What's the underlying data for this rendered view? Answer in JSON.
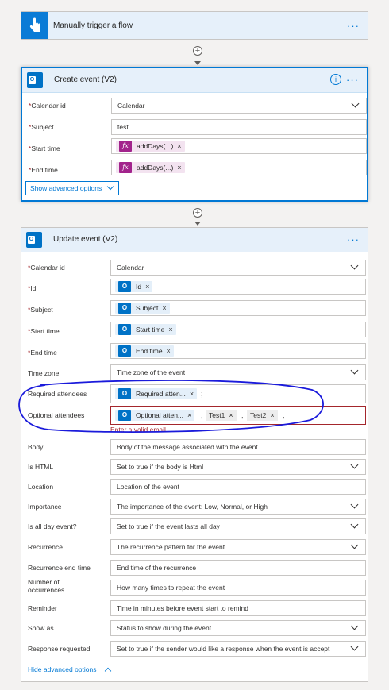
{
  "trigger": {
    "title": "Manually trigger a flow",
    "menu": "···"
  },
  "create": {
    "title": "Create event (V2)",
    "menu": "···",
    "info": "i",
    "rows": [
      {
        "label": "Calendar id",
        "required": "*",
        "value": "Calendar"
      },
      {
        "label": "Subject",
        "required": "*",
        "value": "test"
      },
      {
        "label": "Start time",
        "required": "*",
        "token": "addDays(...)",
        "fx": "fx"
      },
      {
        "label": "End time",
        "required": "*",
        "token": "addDays(...)",
        "fx": "fx"
      }
    ],
    "advanced": "Show advanced options"
  },
  "update": {
    "title": "Update event (V2)",
    "menu": "···",
    "calendar": {
      "label": "Calendar id",
      "value": "Calendar"
    },
    "id": {
      "label": "Id",
      "token": "Id"
    },
    "subject": {
      "label": "Subject",
      "token": "Subject"
    },
    "start": {
      "label": "Start time",
      "token": "Start time"
    },
    "end": {
      "label": "End time",
      "token": "End time"
    },
    "timezone": {
      "label": "Time zone",
      "placeholder": "Time zone of the event"
    },
    "required_att": {
      "label": "Required attendees",
      "token": "Required atten..."
    },
    "optional_att": {
      "label": "Optional attendees",
      "token": "Optional atten...",
      "extra": [
        "Test1",
        "Test2"
      ]
    },
    "error": "Enter a valid email",
    "fields": [
      {
        "label": "Body",
        "placeholder": "Body of the message associated with the event",
        "dropdown": false
      },
      {
        "label": "Is HTML",
        "placeholder": "Set to true if the body is Html",
        "dropdown": true
      },
      {
        "label": "Location",
        "placeholder": "Location of the event",
        "dropdown": false
      },
      {
        "label": "Importance",
        "placeholder": "The importance of the event: Low, Normal, or High",
        "dropdown": true
      },
      {
        "label": "Is all day event?",
        "placeholder": "Set to true if the event lasts all day",
        "dropdown": true
      },
      {
        "label": "Recurrence",
        "placeholder": "The recurrence pattern for the event",
        "dropdown": true
      },
      {
        "label": "Recurrence end time",
        "placeholder": "End time of the recurrence",
        "dropdown": false
      },
      {
        "label": "Number of occurrences",
        "placeholder": "How many times to repeat the event",
        "dropdown": false
      },
      {
        "label": "Reminder",
        "placeholder": "Time in minutes before event start to remind",
        "dropdown": false
      },
      {
        "label": "Show as",
        "placeholder": "Status to show during the event",
        "dropdown": true
      },
      {
        "label": "Response requested",
        "placeholder": "Set to true if the sender would like a response when the event is accept",
        "dropdown": true
      }
    ],
    "advanced": "Hide advanced options"
  },
  "colors": {
    "accent": "#0078d4",
    "error": "#a4262c",
    "annotation": "#1a1adb",
    "fx": "#a2238c",
    "outlook": "#0072c6"
  }
}
